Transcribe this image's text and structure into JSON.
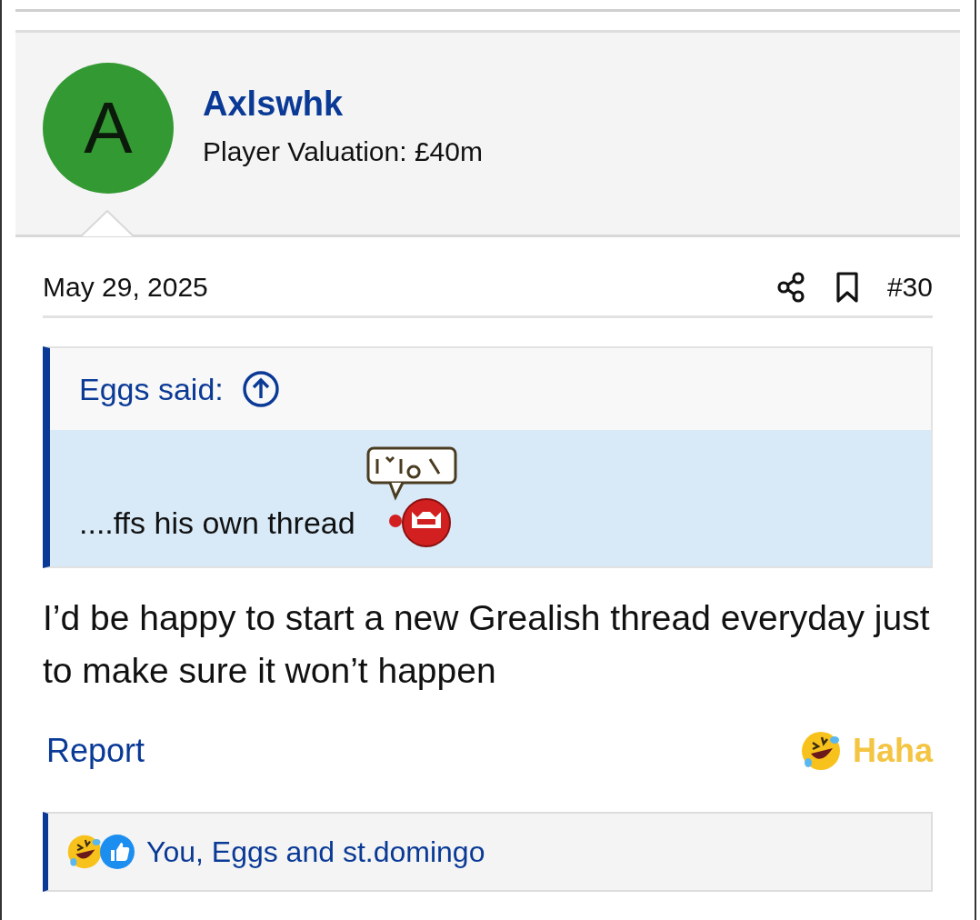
{
  "author": {
    "avatar_letter": "A",
    "name": "Axlswhk",
    "title": "Player Valuation: £40m"
  },
  "post": {
    "date": "May 29, 2025",
    "number": "#30",
    "quote": {
      "attribution": "Eggs said:",
      "text": "....ffs his own thread"
    },
    "message": "I’d be happy to start a new Grealish thread everyday just to make sure it won’t happen"
  },
  "actions": {
    "report": "Report",
    "reaction": "Haha"
  },
  "reactions_bar": {
    "text": "You, Eggs and st.domingo"
  }
}
